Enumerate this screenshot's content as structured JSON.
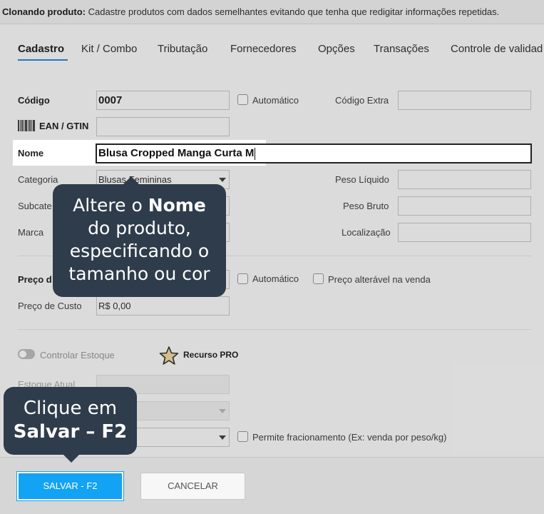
{
  "banner": {
    "title": "Clonando produto:",
    "text": "Cadastre produtos com dados semelhantes evitando que tenha que redigitar informações repetidas."
  },
  "tabs": [
    "Cadastro",
    "Kit / Combo",
    "Tributação",
    "Fornecedores",
    "Opções",
    "Transações",
    "Controle de validad"
  ],
  "form": {
    "codigo_label": "Código",
    "codigo_value": "0007",
    "automatico_label": "Automático",
    "codigo_extra_label": "Código Extra",
    "ean_label": "EAN / GTIN",
    "nome_label": "Nome",
    "nome_value": "Blusa Cropped Manga Curta M",
    "categoria_label": "Categoria",
    "categoria_value": "Blusas Femininas",
    "subcategoria_label": "Subcate",
    "marca_label": "Marca",
    "peso_liquido_label": "Peso Líquido",
    "peso_bruto_label": "Peso Bruto",
    "localizacao_label": "Localização",
    "preco_label": "Preço d",
    "automatico2_label": "Automático",
    "preco_alteravel_label": "Preço alterável na venda",
    "preco_custo_label": "Preço de Custo",
    "preco_custo_value": "R$ 0,00",
    "controlar_estoque_label": "Controlar Estoque",
    "recurso_pro_label": "Recurso PRO",
    "estoque_atual_label": "Estoque Atual",
    "fracionamento_label": "Permite fracionamento (Ex: venda por peso/kg)"
  },
  "tooltip_nome": {
    "line1_pre": "Altere o ",
    "line1_bold": "Nome",
    "line2": "do produto,",
    "line3": "especificando o",
    "line4": "tamanho ou cor"
  },
  "tooltip_salvar": {
    "line1": "Clique em",
    "line2": "Salvar – F2"
  },
  "footer": {
    "save_label": "SALVAR - F2",
    "cancel_label": "CANCELAR"
  },
  "colors": {
    "accent": "#12a3f5",
    "tooltip_bg": "#2f3c4b",
    "tab_underline": "#2a8ad6"
  }
}
